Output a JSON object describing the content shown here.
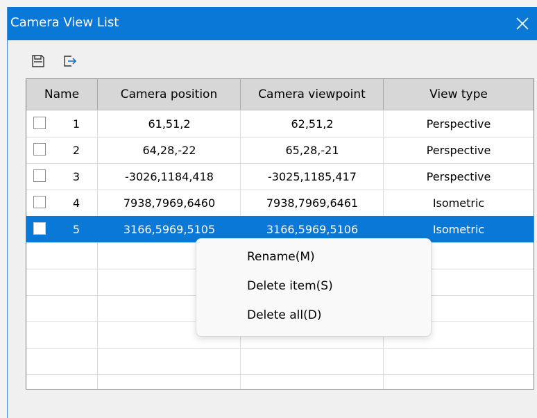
{
  "window": {
    "title": "Camera View List"
  },
  "toolbar": {
    "save_icon": "save-icon",
    "export_icon": "export-icon"
  },
  "table": {
    "columns": [
      "Name",
      "Camera position",
      "Camera viewpoint",
      "View type"
    ],
    "rows": [
      {
        "name": "1",
        "position": "61,51,2",
        "viewpoint": "62,51,2",
        "type": "Perspective",
        "checked": false,
        "selected": false
      },
      {
        "name": "2",
        "position": "64,28,-22",
        "viewpoint": "65,28,-21",
        "type": "Perspective",
        "checked": false,
        "selected": false
      },
      {
        "name": "3",
        "position": "-3026,1184,418",
        "viewpoint": "-3025,1185,417",
        "type": "Perspective",
        "checked": false,
        "selected": false
      },
      {
        "name": "4",
        "position": "7938,7969,6460",
        "viewpoint": "7938,7969,6461",
        "type": "Isometric",
        "checked": false,
        "selected": false
      },
      {
        "name": "5",
        "position": "3166,5969,5105",
        "viewpoint": "3166,5969,5106",
        "type": "Isometric",
        "checked": false,
        "selected": true
      }
    ]
  },
  "context_menu": {
    "items": [
      "Rename(M)",
      "Delete item(S)",
      "Delete all(D)"
    ]
  },
  "colors": {
    "accent": "#0a78d7",
    "header_bg": "#d7d7d7"
  }
}
